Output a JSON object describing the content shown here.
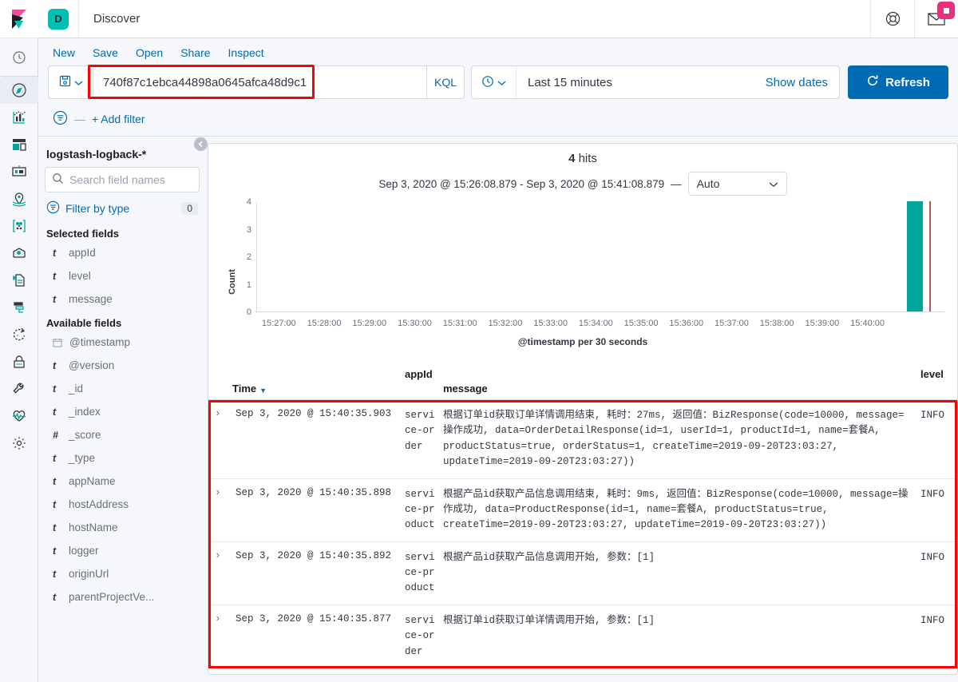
{
  "app": {
    "badge_letter": "D",
    "title": "Discover",
    "logo_icon": "kibana-logo-icon",
    "help_icon": "help-circle-icon",
    "notifications_icon": "mail-envelope-icon"
  },
  "rail": {
    "clock_icon": "recently-viewed-clock-icon",
    "items": [
      {
        "name": "sidebar-item-discover",
        "icon": "compass-icon",
        "active": true
      },
      {
        "name": "sidebar-item-visualize",
        "icon": "bar-chart-icon",
        "active": false
      },
      {
        "name": "sidebar-item-dashboard",
        "icon": "dashboard-panels-icon",
        "active": false
      },
      {
        "name": "sidebar-item-canvas",
        "icon": "canvas-presentation-icon",
        "active": false
      },
      {
        "name": "sidebar-item-maps",
        "icon": "map-marker-icon",
        "active": false
      },
      {
        "name": "sidebar-item-machine-learning",
        "icon": "machine-learning-dots-icon",
        "active": false
      },
      {
        "name": "sidebar-item-infrastructure",
        "icon": "infra-cloud-icon",
        "active": false
      },
      {
        "name": "sidebar-item-logs",
        "icon": "logs-page-icon",
        "active": false
      },
      {
        "name": "sidebar-item-apm",
        "icon": "apm-trace-icon",
        "active": false
      },
      {
        "name": "sidebar-item-uptime",
        "icon": "uptime-refresh-icon",
        "active": false
      },
      {
        "name": "sidebar-item-siem",
        "icon": "lock-security-icon",
        "active": false
      },
      {
        "name": "sidebar-item-dev-tools",
        "icon": "wrench-icon",
        "active": false
      },
      {
        "name": "sidebar-item-monitoring",
        "icon": "heart-pulse-icon",
        "active": false
      },
      {
        "name": "sidebar-item-management",
        "icon": "gear-icon",
        "active": false
      }
    ]
  },
  "topnav": {
    "items": [
      {
        "label": "New",
        "name": "topnav-new"
      },
      {
        "label": "Save",
        "name": "topnav-save"
      },
      {
        "label": "Open",
        "name": "topnav-open"
      },
      {
        "label": "Share",
        "name": "topnav-share"
      },
      {
        "label": "Inspect",
        "name": "topnav-inspect"
      }
    ]
  },
  "query_bar": {
    "saved_query_icon": "save-floppy-icon",
    "chevron_icon": "chevron-down-icon",
    "query_value": "740f87c1ebca44898a0645afca48d9c1",
    "query_placeholder": "Search",
    "language_label": "KQL",
    "time_icon": "clock-icon",
    "time_range": "Last 15 minutes",
    "show_dates_label": "Show dates",
    "refresh_label": "Refresh",
    "refresh_icon": "refresh-icon"
  },
  "filter_bar": {
    "filter_icon": "filter-funnel-icon",
    "separator": "—",
    "add_filter_label": "+ Add filter"
  },
  "sidebar": {
    "index_pattern": "logstash-logback-*",
    "search_icon": "search-icon",
    "search_placeholder": "Search field names",
    "filter_by_type_icon": "filter-funnel-icon",
    "filter_by_type_label": "Filter by type",
    "filter_by_type_count": "0",
    "collapse_icon": "chevron-left-circle-icon",
    "selected_fields_heading": "Selected fields",
    "selected_fields": [
      {
        "type": "t",
        "name": "appId"
      },
      {
        "type": "t",
        "name": "level"
      },
      {
        "type": "t",
        "name": "message"
      }
    ],
    "available_fields_heading": "Available fields",
    "available_fields": [
      {
        "type": "cal",
        "name": "@timestamp"
      },
      {
        "type": "t",
        "name": "@version"
      },
      {
        "type": "t",
        "name": "_id"
      },
      {
        "type": "t",
        "name": "_index"
      },
      {
        "type": "#",
        "name": "_score"
      },
      {
        "type": "t",
        "name": "_type"
      },
      {
        "type": "t",
        "name": "appName"
      },
      {
        "type": "t",
        "name": "hostAddress"
      },
      {
        "type": "t",
        "name": "hostName"
      },
      {
        "type": "t",
        "name": "logger"
      },
      {
        "type": "t",
        "name": "originUrl"
      },
      {
        "type": "t",
        "name": "parentProjectVe..."
      }
    ]
  },
  "results": {
    "hits_count": "4",
    "hits_label": "hits",
    "time_range_text": "Sep 3, 2020 @ 15:26:08.879 - Sep 3, 2020 @ 15:41:08.879",
    "range_dash": "—",
    "interval_value": "Auto",
    "interval_chevron_icon": "chevron-down-icon"
  },
  "chart_data": {
    "type": "bar",
    "title": "",
    "xlabel": "@timestamp per 30 seconds",
    "ylabel": "Count",
    "ylim": [
      0,
      4
    ],
    "yticks": [
      0,
      1,
      2,
      3,
      4
    ],
    "grid": false,
    "legend": "none",
    "bar_color": "#00a69b",
    "marker_color": "#bd5252",
    "marker_label": "current time",
    "categories": [
      "15:27:00",
      "15:28:00",
      "15:29:00",
      "15:30:00",
      "15:31:00",
      "15:32:00",
      "15:33:00",
      "15:34:00",
      "15:35:00",
      "15:36:00",
      "15:37:00",
      "15:38:00",
      "15:39:00",
      "15:40:00"
    ],
    "x_tick_labels": [
      "15:27:00",
      "15:28:00",
      "15:29:00",
      "15:30:00",
      "15:31:00",
      "15:32:00",
      "15:33:00",
      "15:34:00",
      "15:35:00",
      "15:36:00",
      "15:37:00",
      "15:38:00",
      "15:39:00",
      "15:40:00"
    ],
    "bars": [
      {
        "x": "15:40:30",
        "value": 4
      }
    ],
    "values": [
      0,
      0,
      0,
      0,
      0,
      0,
      0,
      0,
      0,
      0,
      0,
      0,
      0,
      4
    ]
  },
  "table": {
    "columns": [
      {
        "key": "time",
        "label": "Time",
        "sorted": "desc",
        "sort_icon": "sort-down-caret-icon"
      },
      {
        "key": "appId",
        "label": "appId"
      },
      {
        "key": "message",
        "label": "message"
      },
      {
        "key": "level",
        "label": "level"
      }
    ],
    "expand_icon": "chevron-right-expand-icon",
    "rows": [
      {
        "time": "Sep 3, 2020 @ 15:40:35.903",
        "appId": "service-order",
        "message": "根据订单id获取订单详情调用结束, 耗时：27ms, 返回值：BizResponse(code=10000, message=操作成功, data=OrderDetailResponse(id=1, userId=1, productId=1, name=套餐A, productStatus=true, orderStatus=1, createTime=2019-09-20T23:03:27, updateTime=2019-09-20T23:03:27))",
        "level": "INFO"
      },
      {
        "time": "Sep 3, 2020 @ 15:40:35.898",
        "appId": "service-product",
        "message": "根据产品id获取产品信息调用结束, 耗时：9ms, 返回值：BizResponse(code=10000, message=操作成功, data=ProductResponse(id=1, name=套餐A, productStatus=true, createTime=2019-09-20T23:03:27, updateTime=2019-09-20T23:03:27))",
        "level": "INFO"
      },
      {
        "time": "Sep 3, 2020 @ 15:40:35.892",
        "appId": "service-product",
        "message": "根据产品id获取产品信息调用开始, 参数：[1]",
        "level": "INFO"
      },
      {
        "time": "Sep 3, 2020 @ 15:40:35.877",
        "appId": "service-order",
        "message": "根据订单id获取订单详情调用开始, 参数：[1]",
        "level": "INFO"
      }
    ]
  },
  "annotations": {
    "highlight_color": "#ff0000",
    "boxes": [
      "query-input-highlight",
      "results-table-highlight"
    ]
  }
}
